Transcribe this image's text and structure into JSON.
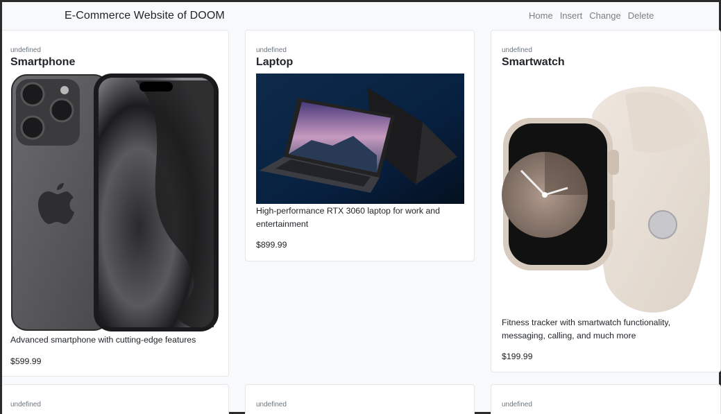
{
  "navbar": {
    "brand": "E-Commerce Website of DOOM",
    "links": [
      "Home",
      "Insert",
      "Change",
      "Delete"
    ]
  },
  "products": [
    {
      "category": "undefined",
      "name": "Smartphone",
      "description": "Advanced smartphone with cutting-edge features",
      "price": "$599.99"
    },
    {
      "category": "undefined",
      "name": "Laptop",
      "description": "High-performance RTX 3060 laptop for work and entertainment",
      "price": "$899.99"
    },
    {
      "category": "undefined",
      "name": "Smartwatch",
      "description": "Fitness tracker with smartwatch functionality, messaging, calling, and much more",
      "price": "$199.99"
    },
    {
      "category": "undefined"
    },
    {
      "category": "undefined"
    },
    {
      "category": "undefined"
    }
  ],
  "colors": {
    "page_bg": "#f8f9fa",
    "card_bg": "#ffffff",
    "nav_link": "#7a7f85",
    "muted": "#6c757d"
  }
}
